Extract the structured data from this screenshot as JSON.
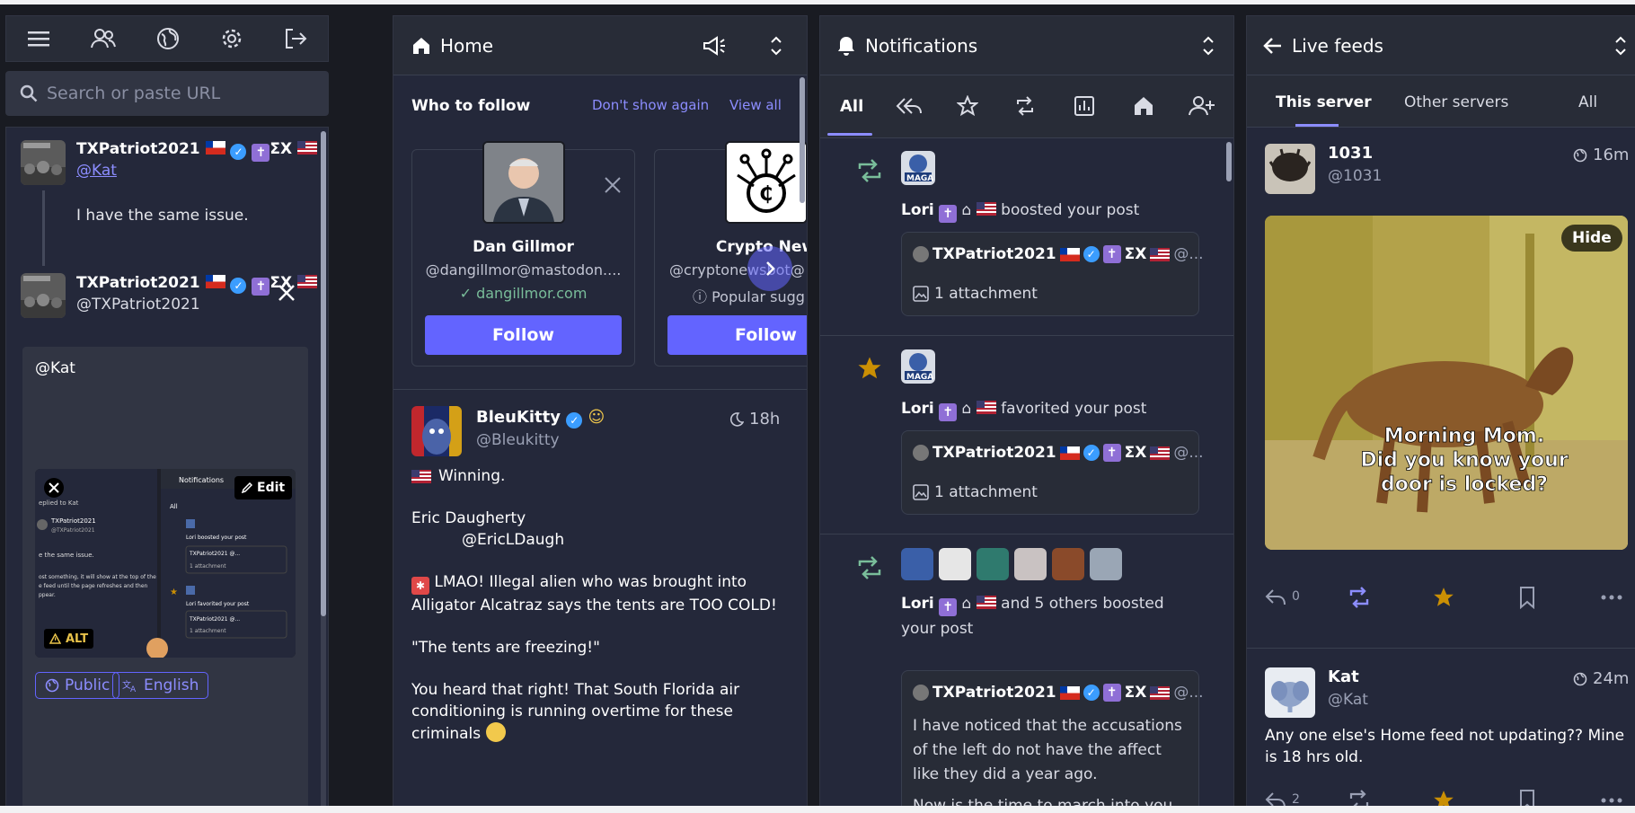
{
  "compose": {
    "search_placeholder": "Search or paste URL",
    "reply_to": {
      "name": "TXPatriot2021",
      "handle": "@Kat",
      "text": "I have the same issue."
    },
    "account": {
      "name": "TXPatriot2021",
      "handle": "@TXPatriot2021"
    },
    "textarea_value": "@Kat",
    "edit_label": "Edit",
    "alt_label": "ALT",
    "visibility_label": "Public",
    "language_label": "English"
  },
  "home": {
    "title": "Home",
    "who_to_follow": "Who to follow",
    "dont_show": "Don't show again",
    "view_all": "View all",
    "cards": [
      {
        "name": "Dan Gillmor",
        "handle": "@dangillmor@mastodon....",
        "link": "dangillmor.com",
        "follow": "Follow"
      },
      {
        "name": "Crypto New",
        "handle": "@cryptonewsbot@",
        "link": "Popular sugg",
        "follow": "Follow"
      }
    ],
    "post": {
      "name": "BleuKitty",
      "handle": "@Bleukitty",
      "time": "18h",
      "lines": [
        "Winning.",
        "Eric Daugherty",
        "@EricLDaugh",
        "LMAO! Illegal alien who was brought into",
        "Alligator Alcatraz says the tents are TOO COLD!",
        "\"The tents are freezing!\"",
        "You heard that right! That South Florida air",
        "conditioning is running overtime for these",
        "criminals"
      ]
    }
  },
  "notifications": {
    "title": "Notifications",
    "tab_all": "All",
    "items": [
      {
        "actor": "Lori",
        "action": "boosted your post",
        "quote_name": "TXPatriot2021",
        "quote_tail": "@...",
        "attachment": "1 attachment"
      },
      {
        "actor": "Lori",
        "action": "favorited your post",
        "quote_name": "TXPatriot2021",
        "quote_tail": "@...",
        "attachment": "1 attachment"
      },
      {
        "actor": "Lori",
        "action": "and 5 others boosted",
        "action2": "your post",
        "quote_name": "TXPatriot2021",
        "quote_tail": "@...",
        "quote_lines": [
          "I have noticed that the accusations",
          "of the left do not have the affect",
          "like they did a year ago."
        ],
        "quote_more": "Now is the time to march into you..."
      }
    ]
  },
  "live": {
    "title": "Live feeds",
    "tabs": [
      "This server",
      "Other servers",
      "All"
    ],
    "posts": [
      {
        "name": "1031",
        "handle": "@1031",
        "time": "16m",
        "hide": "Hide",
        "caption": [
          "Morning Mom.",
          "Did you know your",
          "door is locked?"
        ],
        "replies": "0"
      },
      {
        "name": "Kat",
        "handle": "@Kat",
        "time": "24m",
        "text": [
          "Any one else's Home feed not updating?? Mine",
          "is 18 hrs old."
        ],
        "replies": "2"
      }
    ]
  },
  "colors": {
    "accent": "#6364ff",
    "boost": "#79bd9a",
    "favorite": "#ca8f04",
    "background": "#191b22",
    "panel": "#282c37"
  }
}
